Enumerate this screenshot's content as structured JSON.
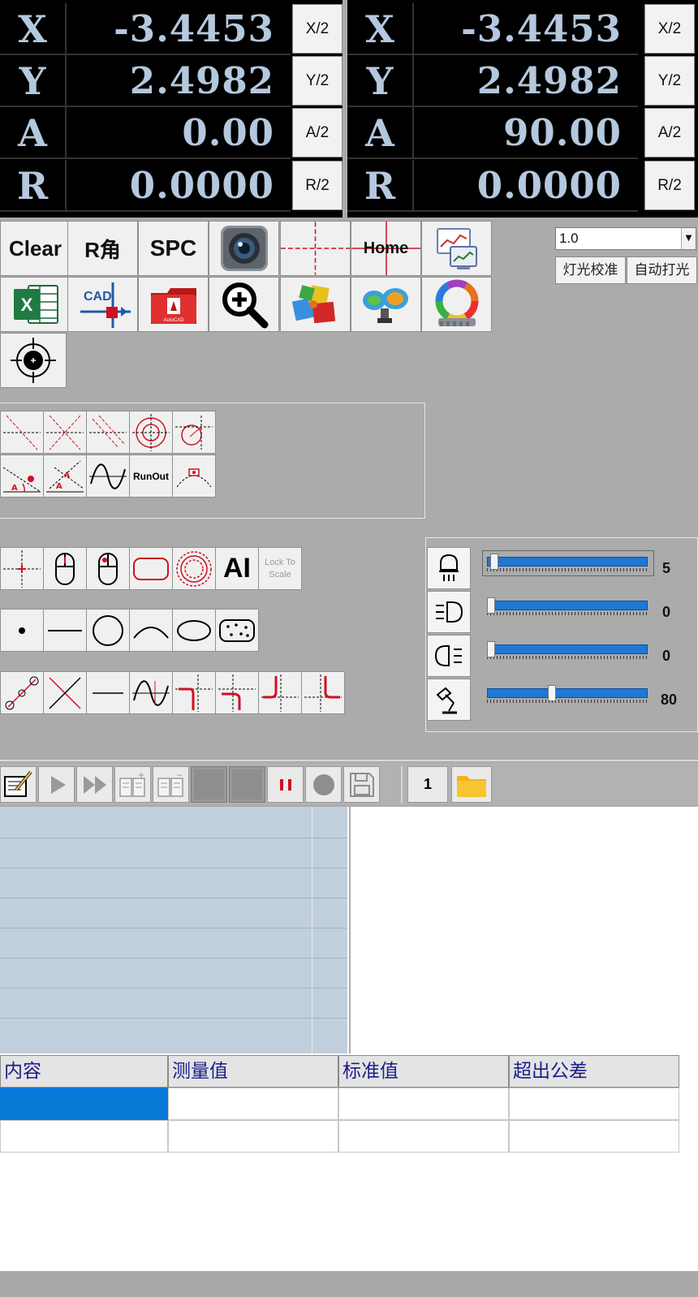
{
  "dro": {
    "left": [
      {
        "axis": "X",
        "value": "-3.4453",
        "half": "X/2"
      },
      {
        "axis": "Y",
        "value": "2.4982",
        "half": "Y/2"
      },
      {
        "axis": "A",
        "value": "0.00",
        "half": "A/2"
      },
      {
        "axis": "R",
        "value": "0.0000",
        "half": "R/2"
      }
    ],
    "right": [
      {
        "axis": "X",
        "value": "-3.4453",
        "half": "X/2"
      },
      {
        "axis": "Y",
        "value": "2.4982",
        "half": "Y/2"
      },
      {
        "axis": "A",
        "value": "90.00",
        "half": "A/2"
      },
      {
        "axis": "R",
        "value": "0.0000",
        "half": "R/2"
      }
    ]
  },
  "toolbar": {
    "clear_label": "Clear",
    "r_angle_label": "R角",
    "spc_label": "SPC",
    "home_label": "Home",
    "cad_label": "CAD",
    "icons": [
      "camera-icon",
      "crosshair-icon",
      "home-icon",
      "monitor-report-icon",
      "excel-icon",
      "cad-icon",
      "autocad-icon",
      "zoom-in-icon",
      "puzzle-icon",
      "binoculars-icon",
      "color-wheel-icon",
      "target-icon"
    ]
  },
  "zoom_select": {
    "value": "1.0"
  },
  "light_buttons": {
    "calibrate": "灯光校准",
    "auto": "自动打光"
  },
  "construct_tools": {
    "runout_label": "RunOut"
  },
  "measure_tools": {
    "ai_label": "AI",
    "lock_label": "Lock To Scale"
  },
  "lights": [
    {
      "name": "ring",
      "value": "5",
      "level": 0.02
    },
    {
      "name": "coaxial",
      "value": "0",
      "level": 0.0
    },
    {
      "name": "contour",
      "value": "0",
      "level": 0.0
    },
    {
      "name": "lamp",
      "value": "80",
      "level": 0.4
    }
  ],
  "program": {
    "step": "1"
  },
  "table": {
    "headers": [
      "内容",
      "测量值",
      "标准值",
      "超出公差"
    ],
    "rows": [
      [
        "",
        "",
        "",
        ""
      ],
      [
        "",
        "",
        "",
        ""
      ]
    ]
  },
  "colors": {
    "dro_bg": "#000000",
    "dro_text": "#b4c8de",
    "accent": "#0a7ad9",
    "panel": "#ababab",
    "red": "#d01020"
  }
}
